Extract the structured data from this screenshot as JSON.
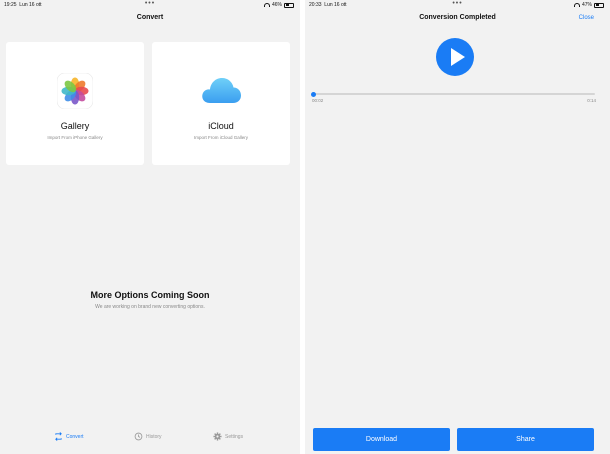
{
  "left": {
    "status": {
      "time": "19:25",
      "date": "Lun 16 ott",
      "battery": "46%",
      "battery_level": 0.46
    },
    "title": "Convert",
    "cards": [
      {
        "title": "Gallery",
        "subtitle": "Import From iPhone Gallery",
        "icon": "photos-icon"
      },
      {
        "title": "iCloud",
        "subtitle": "Import From iCloud Gallery",
        "icon": "icloud-icon"
      }
    ],
    "coming_soon": {
      "title": "More Options Coming Soon",
      "subtitle": "We are working on brand new converting options."
    },
    "tabs": [
      {
        "label": "Convert",
        "icon": "convert-icon",
        "active": true
      },
      {
        "label": "History",
        "icon": "history-icon",
        "active": false
      },
      {
        "label": "Settings",
        "icon": "gear-icon",
        "active": false
      }
    ]
  },
  "right": {
    "status": {
      "time": "20:33",
      "date": "Lun 16 ott",
      "battery": "47%",
      "battery_level": 0.47
    },
    "title": "Conversion Completed",
    "close_label": "Close",
    "player": {
      "elapsed": "00:02",
      "total": "0:14",
      "progress": 0.0
    },
    "buttons": {
      "download": "Download",
      "share": "Share"
    }
  },
  "colors": {
    "accent": "#1a7cf5",
    "background": "#f2f2f2",
    "card": "#ffffff"
  }
}
